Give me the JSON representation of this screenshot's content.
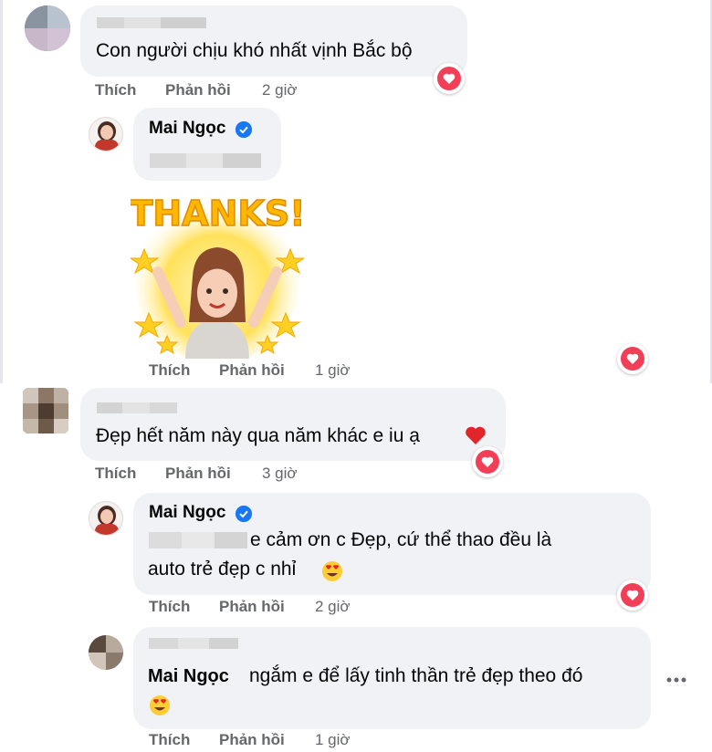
{
  "comments": [
    {
      "text": "Con người chịu khó nhất vịnh Bắc bộ",
      "like": "Thích",
      "reply": "Phản hồi",
      "time": "2 giờ"
    },
    {
      "name": "Mai Ngọc",
      "sticker_text": "THANKS!",
      "like": "Thích",
      "reply": "Phản hồi",
      "time": "1 giờ"
    },
    {
      "text": "Đẹp hết năm này qua năm khác e iu ạ",
      "like": "Thích",
      "reply": "Phản hồi",
      "time": "3 giờ"
    },
    {
      "name": "Mai Ngọc",
      "text_line1": "e cảm ơn c Đẹp, cứ thể thao đều là",
      "text_line2": "auto trẻ đẹp c nhỉ",
      "like": "Thích",
      "reply": "Phản hồi",
      "time": "2 giờ"
    },
    {
      "mention": "Mai Ngọc",
      "text": "ngắm e để lấy tinh thần trẻ đẹp theo đó",
      "like": "Thích",
      "reply": "Phản hồi",
      "time": "1 giờ",
      "more_icon": "more-horizontal-icon"
    }
  ],
  "colors": {
    "bubble": "#f0f2f5",
    "heart": "#f33e58",
    "verified": "#1877f2",
    "meta": "#65676b"
  }
}
